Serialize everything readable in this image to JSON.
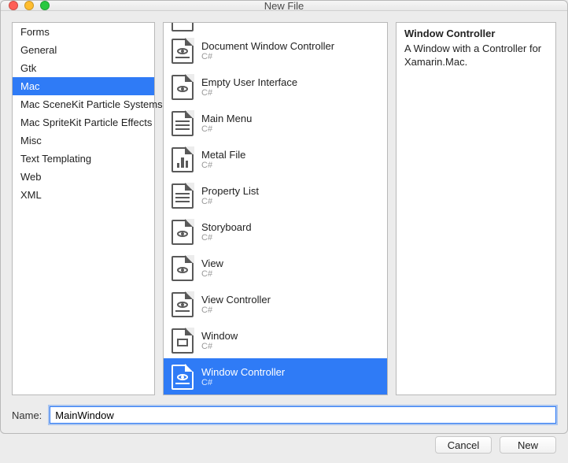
{
  "window": {
    "title": "New File"
  },
  "categories": [
    {
      "label": "Forms",
      "selected": false
    },
    {
      "label": "General",
      "selected": false
    },
    {
      "label": "Gtk",
      "selected": false
    },
    {
      "label": "Mac",
      "selected": true
    },
    {
      "label": "Mac SceneKit Particle Systems",
      "selected": false
    },
    {
      "label": "Mac SpriteKit Particle Effects",
      "selected": false
    },
    {
      "label": "Misc",
      "selected": false
    },
    {
      "label": "Text Templating",
      "selected": false
    },
    {
      "label": "Web",
      "selected": false
    },
    {
      "label": "XML",
      "selected": false
    }
  ],
  "templates": [
    {
      "label": "Document Window Controller",
      "sub": "C#",
      "icon": "doc-eye",
      "selected": false
    },
    {
      "label": "Empty User Interface",
      "sub": "C#",
      "icon": "eye",
      "selected": false
    },
    {
      "label": "Main Menu",
      "sub": "C#",
      "icon": "lines",
      "selected": false
    },
    {
      "label": "Metal File",
      "sub": "C#",
      "icon": "metal",
      "selected": false
    },
    {
      "label": "Property List",
      "sub": "C#",
      "icon": "lines",
      "selected": false
    },
    {
      "label": "Storyboard",
      "sub": "C#",
      "icon": "eye",
      "selected": false
    },
    {
      "label": "View",
      "sub": "C#",
      "icon": "eye",
      "selected": false
    },
    {
      "label": "View Controller",
      "sub": "C#",
      "icon": "doc-eye",
      "selected": false
    },
    {
      "label": "Window",
      "sub": "C#",
      "icon": "rect",
      "selected": false
    },
    {
      "label": "Window Controller",
      "sub": "C#",
      "icon": "doc-eye",
      "selected": true
    }
  ],
  "detail": {
    "title": "Window Controller",
    "description": "A Window with a Controller for Xamarin.Mac."
  },
  "name_row": {
    "label": "Name:",
    "value": "MainWindow"
  },
  "buttons": {
    "cancel": "Cancel",
    "new": "New"
  }
}
